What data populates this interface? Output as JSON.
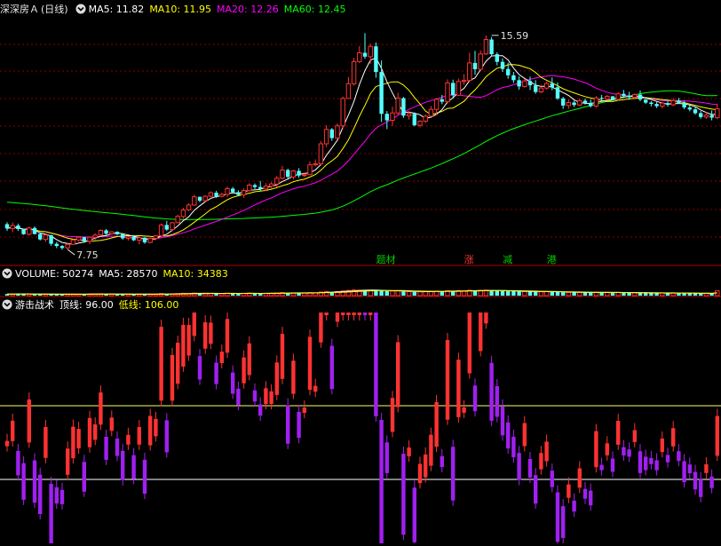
{
  "colors": {
    "bg": "#000000",
    "up": "#ff3232",
    "down": "#54ffff",
    "ma5": "#ffffff",
    "ma10": "#ffff00",
    "ma20": "#ff00ff",
    "ma60": "#00ff00",
    "grid": "#8b0000",
    "ind_up": "#ff3232",
    "ind_down": "#a020f0",
    "ind_line": "#ffff66",
    "bottom_line": "#ffffff"
  },
  "price_panel": {
    "title": "深深房Ａ",
    "period": "(日线)",
    "ma5_label": "MA5: 11.82",
    "ma10_label": "MA10: 11.95",
    "ma20_label": "MA20: 12.26",
    "ma60_label": "MA60: 12.45",
    "high_label": "15.59",
    "low_label": "7.75",
    "tags": [
      {
        "text": "题材",
        "index": 68,
        "color": "#00cc00"
      },
      {
        "text": "涨",
        "index": 84,
        "color": "#ff3333"
      },
      {
        "text": "减",
        "index": 91,
        "color": "#00cc00"
      },
      {
        "text": "港",
        "index": 99,
        "color": "#00cc00"
      }
    ]
  },
  "volume_panel": {
    "title": "VOLUME: 50274",
    "ma5_label": "MA5: 28570",
    "ma10_label": "MA10: 34383"
  },
  "indicator_panel": {
    "title": "游击战术",
    "top_label": "顶线: 96.00",
    "bottom_label": "低线: 106.00"
  },
  "chart_data": [
    {
      "type": "candlestick",
      "title": "深深房Ａ (日线)",
      "ylim": [
        7.2,
        16.3
      ],
      "ma_labels": [
        "MA5: 11.82",
        "MA10: 11.95",
        "MA20: 12.26",
        "MA60: 12.45"
      ],
      "annotations": [
        {
          "text": "15.59",
          "index": 88,
          "value": 15.59
        },
        {
          "text": "7.75",
          "index": 11,
          "value": 7.75
        }
      ],
      "series": [
        {
          "name": "K",
          "ohlc": [
            [
              8.68,
              8.75,
              8.43,
              8.52
            ],
            [
              8.52,
              8.74,
              8.38,
              8.63
            ],
            [
              8.63,
              8.7,
              8.43,
              8.5
            ],
            [
              8.5,
              8.51,
              8.29,
              8.31
            ],
            [
              8.31,
              8.59,
              8.26,
              8.54
            ],
            [
              8.54,
              8.6,
              8.3,
              8.32
            ],
            [
              8.32,
              8.35,
              8.08,
              8.12
            ],
            [
              8.12,
              8.32,
              8.03,
              8.28
            ],
            [
              8.28,
              8.29,
              7.89,
              7.96
            ],
            [
              7.96,
              8.03,
              7.8,
              7.88
            ],
            [
              7.88,
              7.91,
              7.74,
              7.81
            ],
            [
              7.81,
              7.98,
              7.75,
              7.94
            ],
            [
              7.94,
              8.12,
              7.93,
              8.1
            ],
            [
              8.1,
              8.23,
              8.04,
              8.2
            ],
            [
              8.2,
              8.21,
              8.02,
              8.05
            ],
            [
              8.05,
              8.21,
              7.95,
              8.2
            ],
            [
              8.2,
              8.34,
              8.1,
              8.28
            ],
            [
              8.28,
              8.49,
              8.24,
              8.45
            ],
            [
              8.45,
              8.5,
              8.28,
              8.33
            ],
            [
              8.33,
              8.42,
              8.3,
              8.4
            ],
            [
              8.4,
              8.42,
              8.28,
              8.31
            ],
            [
              8.31,
              8.35,
              8.11,
              8.16
            ],
            [
              8.16,
              8.24,
              8.08,
              8.21
            ],
            [
              8.21,
              8.28,
              8.06,
              8.09
            ],
            [
              8.09,
              8.22,
              7.94,
              8.18
            ],
            [
              8.18,
              8.21,
              7.96,
              8.01
            ],
            [
              8.01,
              8.2,
              7.98,
              8.16
            ],
            [
              8.16,
              8.28,
              8.09,
              8.25
            ],
            [
              8.25,
              8.7,
              8.24,
              8.65
            ],
            [
              8.65,
              8.8,
              8.43,
              8.48
            ],
            [
              8.48,
              8.76,
              8.42,
              8.73
            ],
            [
              8.73,
              9.03,
              8.72,
              8.96
            ],
            [
              8.96,
              9.28,
              8.88,
              9.2
            ],
            [
              9.2,
              9.44,
              9.16,
              9.38
            ],
            [
              9.38,
              9.76,
              9.35,
              9.68
            ],
            [
              9.68,
              9.69,
              9.48,
              9.54
            ],
            [
              9.54,
              9.74,
              9.48,
              9.7
            ],
            [
              9.7,
              9.88,
              9.66,
              9.83
            ],
            [
              9.83,
              9.9,
              9.64,
              9.7
            ],
            [
              9.7,
              9.83,
              9.66,
              9.77
            ],
            [
              9.77,
              10.06,
              9.68,
              9.98
            ],
            [
              9.98,
              10.04,
              9.81,
              9.85
            ],
            [
              9.85,
              9.92,
              9.73,
              9.75
            ],
            [
              9.75,
              9.99,
              9.64,
              9.91
            ],
            [
              9.91,
              10.18,
              9.87,
              10.11
            ],
            [
              10.11,
              10.17,
              9.96,
              10.04
            ],
            [
              10.04,
              10.26,
              9.89,
              9.97
            ],
            [
              9.97,
              10.18,
              9.89,
              10.07
            ],
            [
              10.07,
              10.22,
              9.99,
              10.15
            ],
            [
              10.15,
              10.45,
              10.03,
              10.36
            ],
            [
              10.36,
              10.81,
              10.32,
              10.66
            ],
            [
              10.66,
              10.71,
              10.34,
              10.41
            ],
            [
              10.41,
              10.67,
              10.32,
              10.63
            ],
            [
              10.63,
              10.73,
              10.38,
              10.46
            ],
            [
              10.46,
              10.58,
              10.4,
              10.49
            ],
            [
              10.49,
              10.98,
              10.48,
              10.85
            ],
            [
              10.85,
              11.05,
              10.8,
              10.89
            ],
            [
              10.89,
              11.72,
              10.83,
              11.62
            ],
            [
              11.62,
              12.3,
              11.5,
              12.15
            ],
            [
              12.15,
              12.2,
              11.73,
              11.83
            ],
            [
              11.83,
              12.37,
              11.8,
              12.28
            ],
            [
              12.28,
              13.35,
              12.17,
              13.28
            ],
            [
              13.28,
              14.07,
              13.27,
              13.82
            ],
            [
              13.82,
              14.77,
              13.75,
              14.63
            ],
            [
              14.63,
              15.2,
              14.58,
              14.95
            ],
            [
              14.95,
              15.67,
              14.73,
              14.81
            ],
            [
              14.81,
              15.29,
              14.55,
              15.19
            ],
            [
              15.19,
              15.33,
              14.04,
              14.25
            ],
            [
              14.25,
              14.67,
              12.42,
              12.72
            ],
            [
              12.72,
              12.82,
              12.16,
              12.48
            ],
            [
              12.48,
              12.98,
              12.28,
              12.75
            ],
            [
              12.75,
              13.49,
              12.66,
              13.29
            ],
            [
              13.29,
              13.34,
              12.57,
              12.65
            ],
            [
              12.65,
              12.82,
              12.51,
              12.72
            ],
            [
              12.72,
              12.77,
              12.26,
              12.3
            ],
            [
              12.3,
              12.48,
              12.22,
              12.45
            ],
            [
              12.45,
              12.7,
              12.38,
              12.63
            ],
            [
              12.63,
              13.01,
              12.6,
              12.88
            ],
            [
              12.88,
              13.3,
              12.7,
              13.25
            ],
            [
              13.25,
              13.41,
              13.07,
              13.16
            ],
            [
              13.16,
              13.98,
              13.1,
              13.85
            ],
            [
              13.85,
              13.97,
              13.32,
              13.4
            ],
            [
              13.4,
              14.01,
              13.37,
              13.9
            ],
            [
              13.9,
              14.17,
              13.78,
              13.94
            ],
            [
              13.94,
              14.95,
              13.88,
              14.58
            ],
            [
              14.58,
              15.02,
              14.15,
              14.35
            ],
            [
              14.35,
              15.04,
              14.28,
              14.91
            ],
            [
              14.91,
              15.59,
              14.87,
              15.44
            ],
            [
              15.44,
              15.53,
              14.82,
              14.9
            ],
            [
              14.9,
              14.97,
              14.49,
              14.62
            ],
            [
              14.62,
              14.75,
              14.25,
              14.36
            ],
            [
              14.36,
              14.59,
              14.0,
              14.13
            ],
            [
              14.13,
              14.25,
              13.85,
              13.95
            ],
            [
              13.95,
              14.09,
              13.6,
              13.72
            ],
            [
              13.72,
              14.0,
              13.68,
              13.92
            ],
            [
              13.92,
              14.08,
              13.59,
              13.76
            ],
            [
              13.76,
              13.95,
              13.45,
              13.52
            ],
            [
              13.52,
              13.78,
              13.48,
              13.66
            ],
            [
              13.66,
              13.9,
              13.6,
              13.83
            ],
            [
              13.83,
              14.05,
              13.58,
              13.69
            ],
            [
              13.69,
              13.87,
              13.23,
              13.28
            ],
            [
              13.28,
              13.34,
              12.9,
              13.02
            ],
            [
              13.02,
              13.24,
              12.9,
              13.13
            ],
            [
              13.13,
              13.2,
              12.97,
              13.04
            ],
            [
              13.04,
              13.28,
              13.0,
              13.2
            ],
            [
              13.2,
              13.28,
              13.06,
              13.12
            ],
            [
              13.12,
              13.25,
              12.95,
              13.0
            ],
            [
              13.0,
              13.37,
              12.94,
              13.3
            ],
            [
              13.3,
              13.41,
              13.22,
              13.26
            ],
            [
              13.26,
              13.41,
              13.21,
              13.36
            ],
            [
              13.36,
              13.37,
              13.21,
              13.25
            ],
            [
              13.25,
              13.51,
              13.2,
              13.45
            ],
            [
              13.45,
              13.59,
              13.3,
              13.38
            ],
            [
              13.38,
              13.52,
              13.23,
              13.32
            ],
            [
              13.32,
              13.47,
              13.24,
              13.42
            ],
            [
              13.42,
              13.58,
              13.18,
              13.24
            ],
            [
              13.24,
              13.26,
              13.08,
              13.13
            ],
            [
              13.13,
              13.18,
              12.99,
              13.08
            ],
            [
              13.08,
              13.18,
              12.93,
              13.0
            ],
            [
              13.0,
              13.15,
              12.91,
              13.11
            ],
            [
              13.11,
              13.18,
              12.98,
              13.05
            ],
            [
              13.05,
              13.29,
              12.99,
              13.2
            ],
            [
              13.2,
              13.3,
              13.08,
              13.12
            ],
            [
              13.12,
              13.19,
              12.89,
              12.95
            ],
            [
              12.95,
              13.02,
              12.81,
              12.88
            ],
            [
              12.88,
              12.98,
              12.69,
              12.74
            ],
            [
              12.74,
              12.82,
              12.54,
              12.6
            ],
            [
              12.6,
              12.78,
              12.53,
              12.67
            ],
            [
              12.67,
              12.84,
              12.48,
              12.58
            ],
            [
              12.58,
              13.09,
              12.52,
              12.9
            ]
          ]
        }
      ]
    },
    {
      "type": "bar",
      "title": "VOLUME",
      "ylim": [
        0,
        150000
      ],
      "series": [
        {
          "name": "VOLUME",
          "values": [
            16600,
            15500,
            20800,
            17100,
            18500,
            14200,
            12800,
            15900,
            16300,
            14800,
            12300,
            14600,
            17000,
            16100,
            14700,
            16600,
            18400,
            19500,
            16000,
            16500,
            15100,
            14400,
            16300,
            14200,
            17100,
            13700,
            14600,
            16500,
            21500,
            18100,
            18600,
            21300,
            24600,
            24300,
            27100,
            23100,
            24200,
            23400,
            22400,
            21700,
            26300,
            23600,
            21200,
            24100,
            26800,
            24700,
            22300,
            23700,
            24900,
            28500,
            32300,
            27700,
            29500,
            28600,
            26300,
            31700,
            30600,
            38700,
            44100,
            39600,
            43200,
            49600,
            55700,
            60900,
            58000,
            60700,
            55400,
            54500,
            52500,
            46800,
            48400,
            52800,
            43800,
            42500,
            39300,
            40600,
            43400,
            46700,
            48200,
            44700,
            51900,
            49800,
            53700,
            50500,
            56600,
            52300,
            55100,
            57700,
            54800,
            51100,
            49500,
            47400,
            45800,
            43900,
            44500,
            42800,
            40900,
            41700,
            43800,
            40300,
            38200,
            34400,
            35100,
            33700,
            34500,
            33200,
            32300,
            35100,
            33600,
            34200,
            31400,
            32500,
            30800,
            29900,
            31100,
            29300,
            28100,
            27100,
            25900,
            28700,
            27100,
            29100,
            27300,
            25800,
            24400,
            23900,
            22500,
            24100,
            23300,
            50274
          ]
        }
      ]
    },
    {
      "type": "bar",
      "title": "游击战术",
      "top_line": 96.0,
      "bottom_line": 106.0,
      "ylim": [
        90,
        118
      ]
    }
  ]
}
